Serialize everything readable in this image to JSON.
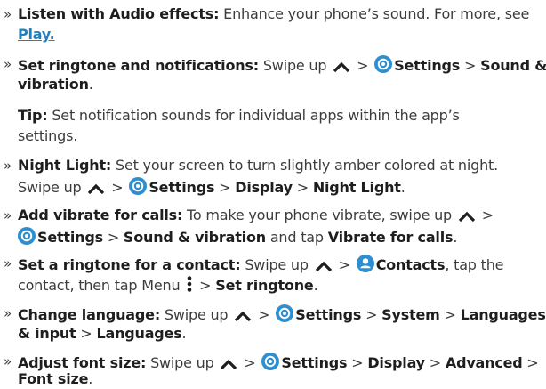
{
  "items": {
    "audio": {
      "label": "Listen with Audio effects:",
      "text": " Enhance your phone’s sound. For more, see",
      "link": "Play."
    },
    "ringtone": {
      "label": "Set ringtone and notifications:",
      "t1": " Swipe up ",
      "settings": "Settings",
      "sound": "Sound &",
      "vibration": "vibration",
      "end": "."
    },
    "tip": {
      "label": "Tip:",
      "text1": " Set notification sounds for individual apps within the app’s",
      "text2": "settings."
    },
    "night": {
      "label": "Night Light:",
      "text1": " Set your screen to turn slightly amber colored at night.",
      "t2": "Swipe up ",
      "settings": "Settings",
      "display": "Display",
      "nightlight": "Night Light",
      "end": "."
    },
    "vibrate": {
      "label": "Add vibrate for calls:",
      "text1": " To make your phone vibrate, swipe up ",
      "settings": "Settings",
      "sv": "Sound & vibration",
      "tap": " and tap ",
      "vfc": "Vibrate for calls",
      "end": "."
    },
    "contact": {
      "label": "Set a ringtone for a contact:",
      "t1": " Swipe up ",
      "contacts": "Contacts",
      "t2": ", tap the",
      "t3": "contact, then tap Menu ",
      "setring": "Set ringtone",
      "end": "."
    },
    "language": {
      "label": "Change language:",
      "t1": " Swipe up ",
      "settings": "Settings",
      "system": "System",
      "languages_input": "Languages",
      "and_input": "& input",
      "languages": "Languages",
      "end": "."
    },
    "font": {
      "label": "Adjust font size:",
      "t1": " Swipe up ",
      "settings": "Settings",
      "display": "Display",
      "advanced": "Advanced",
      "fontsize": "Font size",
      "end": "."
    }
  },
  "symbols": {
    "bullet": "»",
    "sep": " > "
  },
  "colors": {
    "accent": "#1f7fbf",
    "icon": "#2d8fcf",
    "text": "#3c3c3c"
  }
}
